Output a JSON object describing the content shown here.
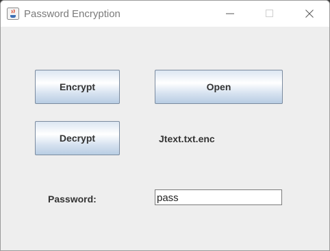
{
  "window": {
    "title": "Password Encryption"
  },
  "buttons": {
    "encrypt": "Encrypt",
    "open": "Open",
    "decrypt": "Decrypt"
  },
  "file_label": "Jtext.txt.enc",
  "password": {
    "label": "Password:",
    "value": "pass"
  }
}
